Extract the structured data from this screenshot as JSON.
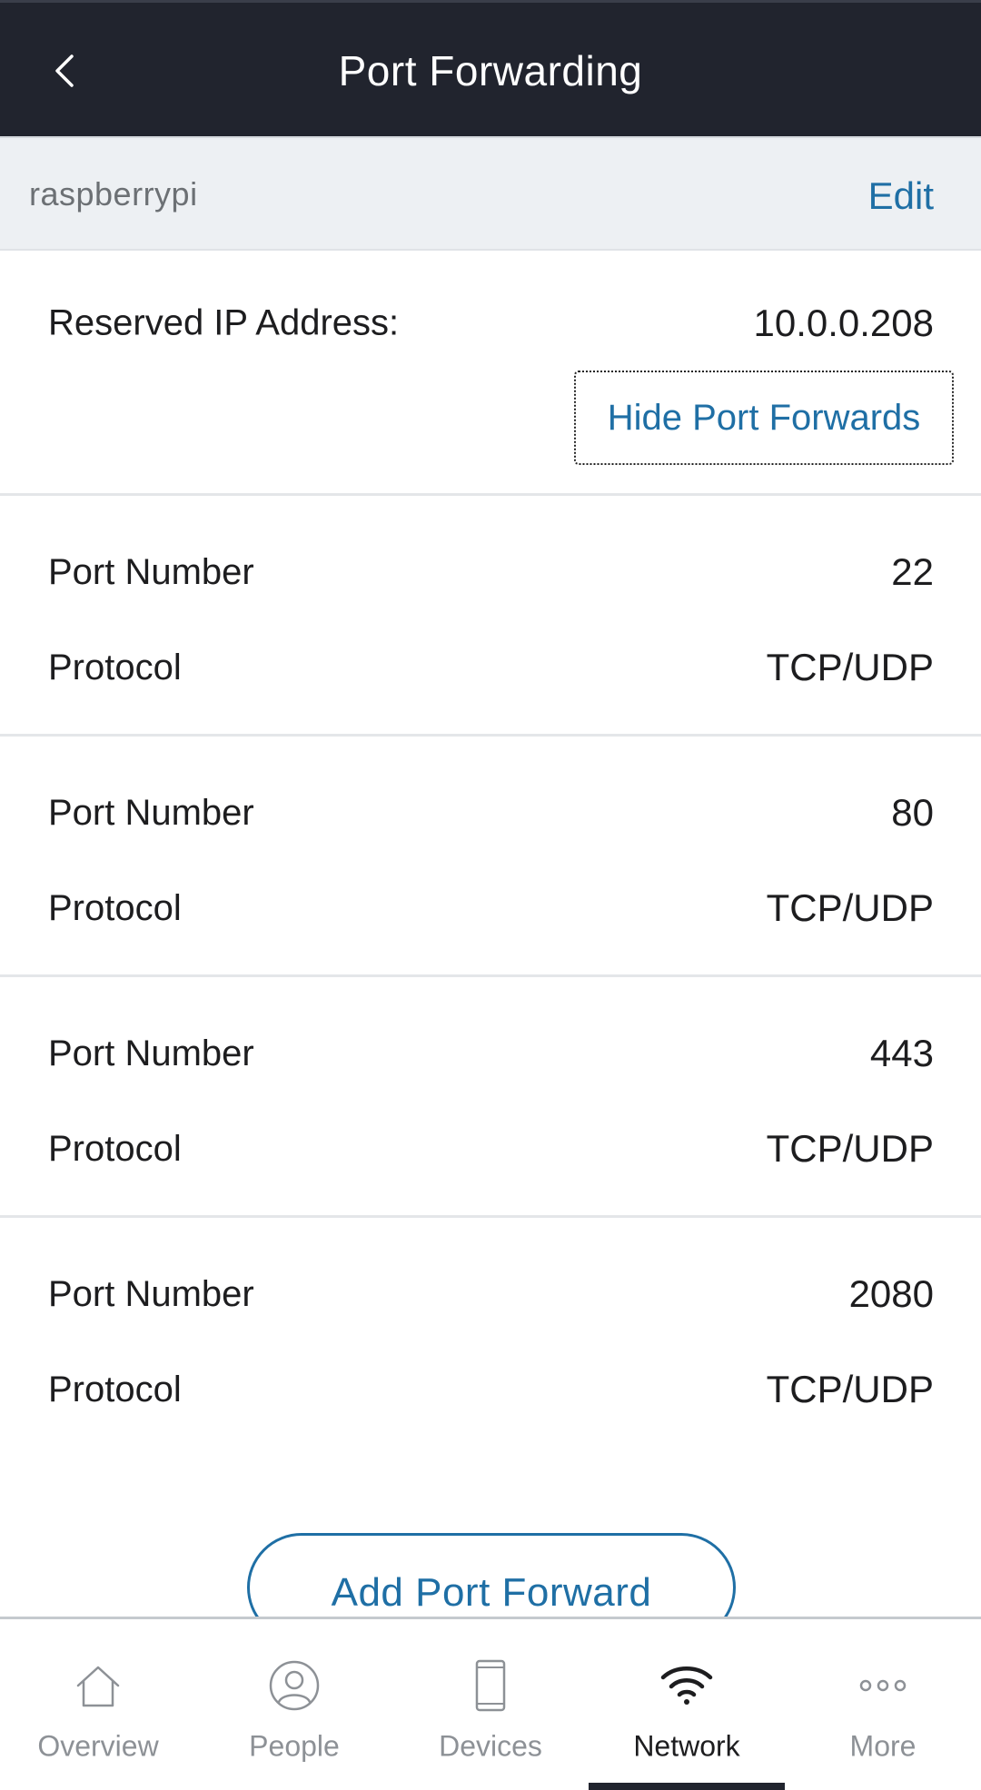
{
  "header": {
    "title": "Port Forwarding"
  },
  "device": {
    "name": "raspberrypi",
    "edit_label": "Edit"
  },
  "reserved_ip": {
    "label": "Reserved IP Address:",
    "value": "10.0.0.208",
    "toggle_label": "Hide Port Forwards"
  },
  "ports": [
    {
      "port_label": "Port Number",
      "port": "22",
      "protocol_label": "Protocol",
      "protocol": "TCP/UDP"
    },
    {
      "port_label": "Port Number",
      "port": "80",
      "protocol_label": "Protocol",
      "protocol": "TCP/UDP"
    },
    {
      "port_label": "Port Number",
      "port": "443",
      "protocol_label": "Protocol",
      "protocol": "TCP/UDP"
    },
    {
      "port_label": "Port Number",
      "port": "2080",
      "protocol_label": "Protocol",
      "protocol": "TCP/UDP"
    }
  ],
  "add_button": {
    "label": "Add Port Forward"
  },
  "nav": {
    "items": [
      {
        "label": "Overview",
        "icon": "home-icon"
      },
      {
        "label": "People",
        "icon": "person-icon"
      },
      {
        "label": "Devices",
        "icon": "phone-icon"
      },
      {
        "label": "Network",
        "icon": "wifi-icon"
      },
      {
        "label": "More",
        "icon": "more-icon"
      }
    ],
    "active": "Network"
  },
  "colors": {
    "header_bg": "#21242e",
    "accent": "#1f6fa5",
    "inactive": "#8d9196",
    "strip_bg": "#edf0f3"
  }
}
